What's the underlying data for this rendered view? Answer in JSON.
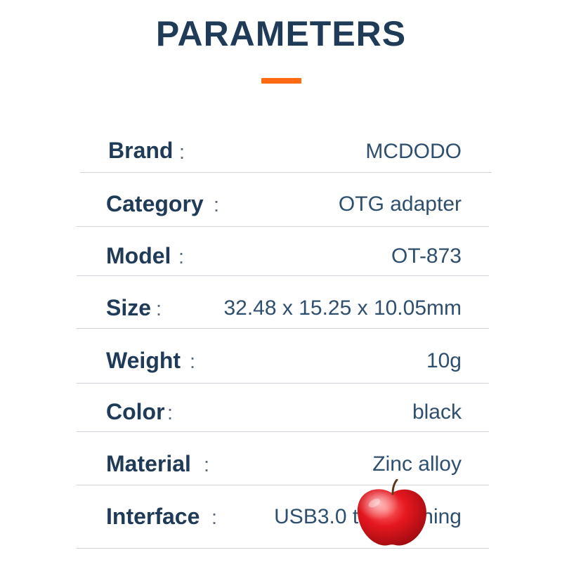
{
  "header": {
    "title": "PARAMETERS",
    "accent_color": "#ff6a13"
  },
  "parameters": [
    {
      "label": "Brand",
      "colon": ":",
      "value": "MCDODO"
    },
    {
      "label": "Category",
      "colon": ":",
      "value": "OTG adapter"
    },
    {
      "label": "Model",
      "colon": ":",
      "value": "OT-873"
    },
    {
      "label": "Size",
      "colon": ":",
      "value": "32.48 x 15.25 x 10.05mm"
    },
    {
      "label": "Weight",
      "colon": ":",
      "value": "10g"
    },
    {
      "label": "Color",
      "colon": ":",
      "value": "black"
    },
    {
      "label": "Material",
      "colon": ":",
      "value": "Zinc alloy"
    },
    {
      "label": "Interface",
      "colon": ":",
      "value": "USB3.0 to Lightning"
    }
  ],
  "overlay": {
    "icon": "apple-icon"
  },
  "colors": {
    "text_primary": "#1f3b57",
    "text_value": "#2f4f6e",
    "divider": "#cfd4da",
    "background": "#ffffff"
  }
}
